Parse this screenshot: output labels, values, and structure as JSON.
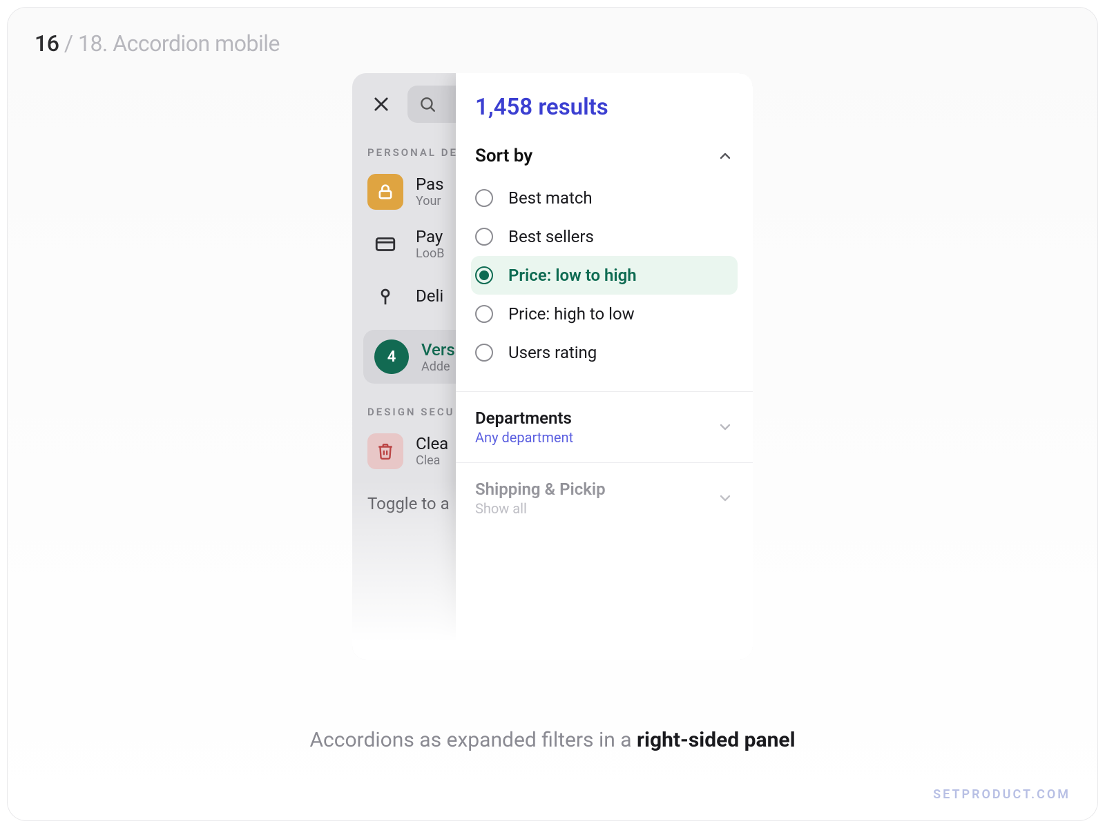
{
  "slide": {
    "current": "16",
    "sep": " / ",
    "rest": "18. Accordion mobile"
  },
  "watermark": "SETPRODUCT.COM",
  "caption": {
    "pre": "Accordions as expanded filters in a ",
    "bold": "right-sided panel"
  },
  "back": {
    "sections": {
      "personal": "PERSONAL DE",
      "design": "DESIGN SECU"
    },
    "rows": {
      "password": {
        "title": "Pas",
        "sub": "Your"
      },
      "payment": {
        "title": "Pay",
        "sub": "LooB"
      },
      "delivery": {
        "title": "Deli"
      },
      "versions": {
        "badge": "4",
        "title": "Vers",
        "sub": "Adde"
      },
      "clear": {
        "title": "Clea",
        "sub": "Clea"
      }
    },
    "toggle": "Toggle to a"
  },
  "panel": {
    "results": "1,458 results",
    "sort": {
      "header": "Sort by",
      "options": [
        {
          "label": "Best match",
          "selected": false
        },
        {
          "label": "Best sellers",
          "selected": false
        },
        {
          "label": "Price: low to high",
          "selected": true
        },
        {
          "label": "Price: high to low",
          "selected": false
        },
        {
          "label": "Users rating",
          "selected": false
        }
      ]
    },
    "departments": {
      "header": "Departments",
      "sub": "Any department"
    },
    "shipping": {
      "header": "Shipping & Pickip",
      "sub": "Show all"
    }
  }
}
